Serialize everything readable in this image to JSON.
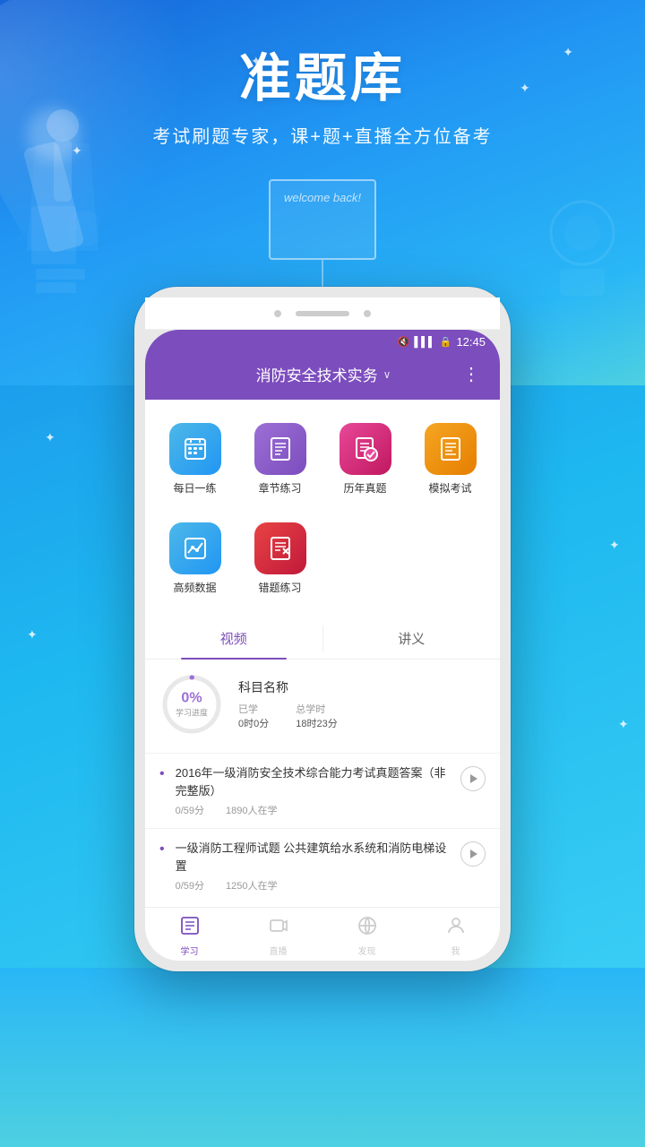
{
  "hero": {
    "title": "准题库",
    "subtitle": "考试刷题专家，课+题+直播全方位备考",
    "welcome_text": "welcome back!"
  },
  "status_bar": {
    "time": "12:45",
    "signal": "⬛",
    "wifi": "📶",
    "battery": "🔋"
  },
  "header": {
    "title": "消防安全技术实务",
    "chevron": "∨",
    "more": "⋮"
  },
  "features_row1": [
    {
      "id": "daily",
      "label": "每日一练",
      "color": "#4db8e8",
      "icon": "📅"
    },
    {
      "id": "chapter",
      "label": "章节练习",
      "color": "#9c6fd6",
      "icon": "📋"
    },
    {
      "id": "past",
      "label": "历年真题",
      "color": "#e84899",
      "icon": "📄"
    },
    {
      "id": "mock",
      "label": "模拟考试",
      "color": "#f5a623",
      "icon": "📝"
    }
  ],
  "features_row2": [
    {
      "id": "freq",
      "label": "高频数据",
      "color": "#4db8e8",
      "icon": "📊"
    },
    {
      "id": "wrong",
      "label": "错题练习",
      "color": "#e84444",
      "icon": "📋"
    }
  ],
  "tabs": [
    {
      "id": "video",
      "label": "视频",
      "active": true
    },
    {
      "id": "notes",
      "label": "讲义",
      "active": false
    }
  ],
  "progress": {
    "percent": "0%",
    "label": "学习进度",
    "subject": "科目名称",
    "studied_label": "已学",
    "studied_value": "0时0分",
    "total_label": "总学时",
    "total_value": "18时23分"
  },
  "courses": [
    {
      "title": "2016年一级消防安全技术综合能力考试真题答案（非完整版）",
      "score": "0/59分",
      "students": "1890人在学"
    },
    {
      "title": "一级消防工程师试题 公共建筑给水系统和消防电梯设置",
      "score": "0/59分",
      "students": "1250人在学"
    }
  ],
  "bottom_nav": [
    {
      "id": "study",
      "label": "学习",
      "icon": "📚",
      "active": true
    },
    {
      "id": "live",
      "label": "直播",
      "icon": "📹",
      "active": false
    },
    {
      "id": "discover",
      "label": "发现",
      "icon": "🔍",
      "active": false
    },
    {
      "id": "me",
      "label": "我",
      "icon": "👤",
      "active": false
    }
  ],
  "icons": {
    "mute": "🔇",
    "signal_bars": "▌▌▌",
    "lock": "🔒",
    "play": "▶"
  }
}
